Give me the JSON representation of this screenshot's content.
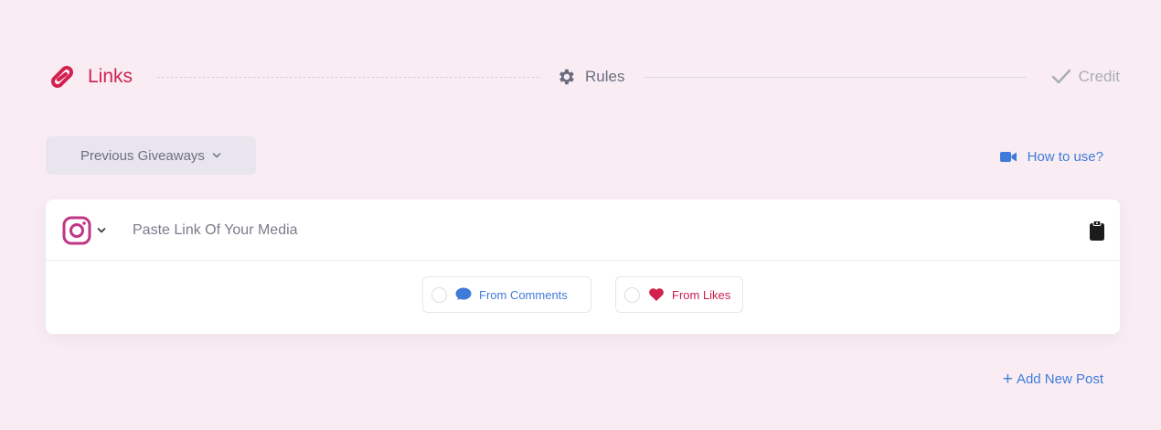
{
  "stepper": {
    "steps": [
      {
        "label": "Links",
        "state": "active",
        "icon": "link-icon"
      },
      {
        "label": "Rules",
        "state": "pending",
        "icon": "gear-icon"
      },
      {
        "label": "Credit",
        "state": "pending",
        "icon": "check-icon"
      }
    ]
  },
  "toolbar": {
    "previous_giveaways_label": "Previous Giveaways",
    "how_to_use_label": "How to use?",
    "how_to_use_icon": "video-camera-icon"
  },
  "media": {
    "platform_icon": "instagram-icon",
    "link_placeholder": "Paste Link Of Your Media",
    "link_value": "",
    "paste_icon": "clipboard-icon",
    "sources": [
      {
        "label": "From Comments",
        "icon": "comment-icon",
        "selected": false
      },
      {
        "label": "From Likes",
        "icon": "heart-icon",
        "selected": false
      }
    ]
  },
  "footer": {
    "add_new_post_label": "Add New Post"
  },
  "colors": {
    "background": "#f9edf3",
    "accent_red": "#d2204f",
    "accent_blue": "#3f7bd9",
    "instagram": "#c13584"
  }
}
